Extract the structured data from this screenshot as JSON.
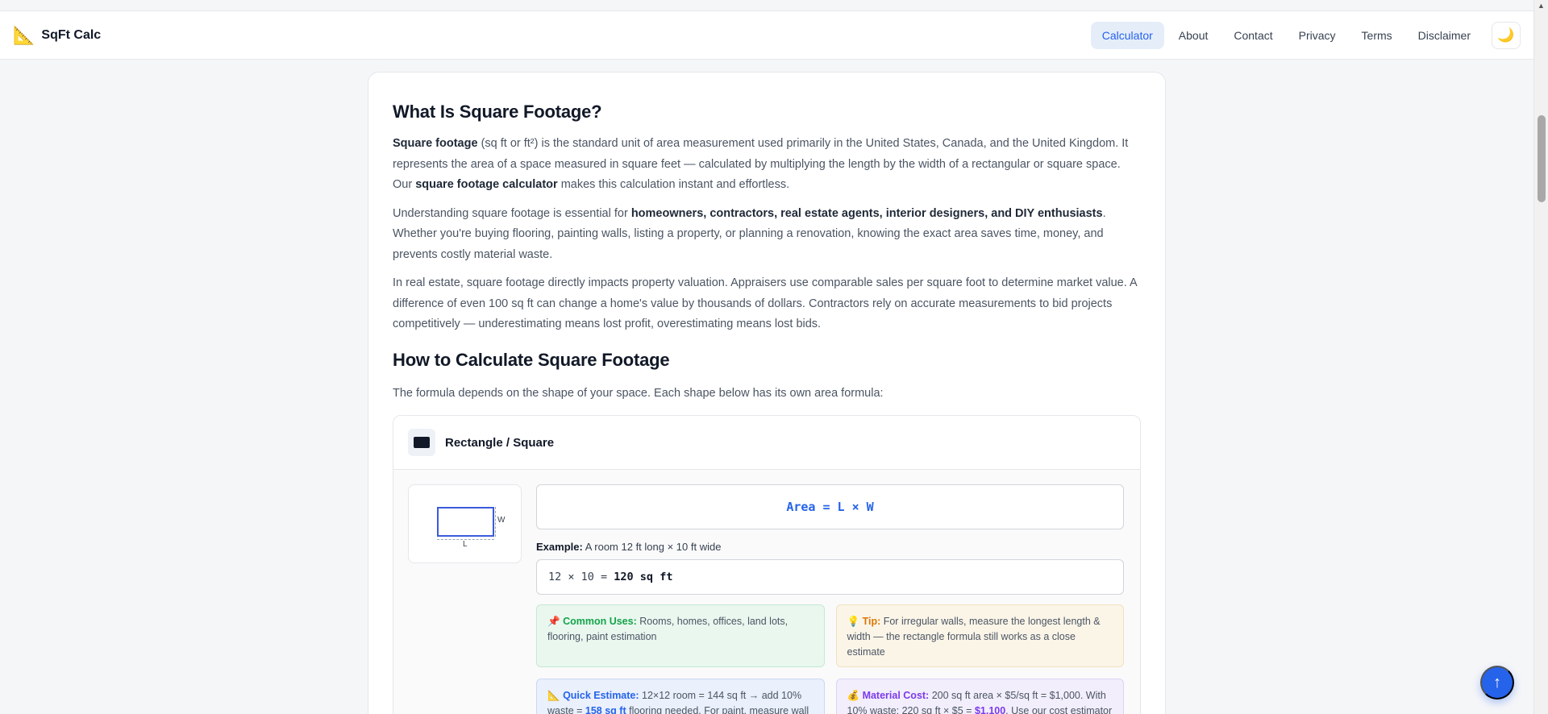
{
  "nav": {
    "brand_icon": "📐",
    "brand": "SqFt Calc",
    "links": [
      {
        "label": "Calculator",
        "active": true
      },
      {
        "label": "About"
      },
      {
        "label": "Contact"
      },
      {
        "label": "Privacy"
      },
      {
        "label": "Terms"
      },
      {
        "label": "Disclaimer"
      }
    ],
    "theme_icon": "🌙"
  },
  "section1": {
    "title": "What Is Square Footage?",
    "p1": {
      "b1": "Square footage",
      "t1": " (sq ft or ft²) is the standard unit of area measurement used primarily in the United States, Canada, and the United Kingdom. It represents the area of a space measured in square feet — calculated by multiplying the length by the width of a rectangular or square space. Our ",
      "b2": "square footage calculator",
      "t2": " makes this calculation instant and effortless."
    },
    "p2": {
      "t1": "Understanding square footage is essential for ",
      "b1": "homeowners, contractors, real estate agents, interior designers, and DIY enthusiasts",
      "t2": ". Whether you're buying flooring, painting walls, listing a property, or planning a renovation, knowing the exact area saves time, money, and prevents costly material waste."
    },
    "p3": "In real estate, square footage directly impacts property valuation. Appraisers use comparable sales per square foot to determine market value. A difference of even 100 sq ft can change a home's value by thousands of dollars. Contractors rely on accurate measurements to bid projects competitively — underestimating means lost profit, overestimating means lost bids."
  },
  "section2": {
    "title": "How to Calculate Square Footage",
    "intro": "The formula depends on the shape of your space. Each shape below has its own area formula:"
  },
  "shape": {
    "title": "Rectangle / Square",
    "diagram": {
      "w": "W",
      "l": "L"
    },
    "formula": "Area = L × W",
    "example_label": "Example:",
    "example_text": " A room 12 ft long × 10 ft wide",
    "calc_expr": "12 × 10 = ",
    "calc_result": "120 sq ft",
    "tips": {
      "uses": {
        "icon": "📌",
        "label": "Common Uses:",
        "text": " Rooms, homes, offices, land lots, flooring, paint estimation"
      },
      "tip": {
        "icon": "💡",
        "label": "Tip:",
        "text": " For irregular walls, measure the longest length & width — the rectangle formula still works as a close estimate"
      },
      "quick": {
        "icon": "📐",
        "label": "Quick Estimate:",
        "t1": " 12×12 room = 144 sq ft → add 10% waste = ",
        "hl": "158 sq ft",
        "t2": " flooring needed. For paint, measure wall perimeter × height (minus doors/windows)."
      },
      "cost": {
        "icon": "💰",
        "label": "Material Cost:",
        "t1": " 200 sq ft area × $5/sq ft = $1,000. With 10% waste: 220 sq ft × $5 = ",
        "hl": "$1,100",
        "t2": ". Use our cost estimator above!"
      }
    }
  },
  "fab_icon": "↑"
}
